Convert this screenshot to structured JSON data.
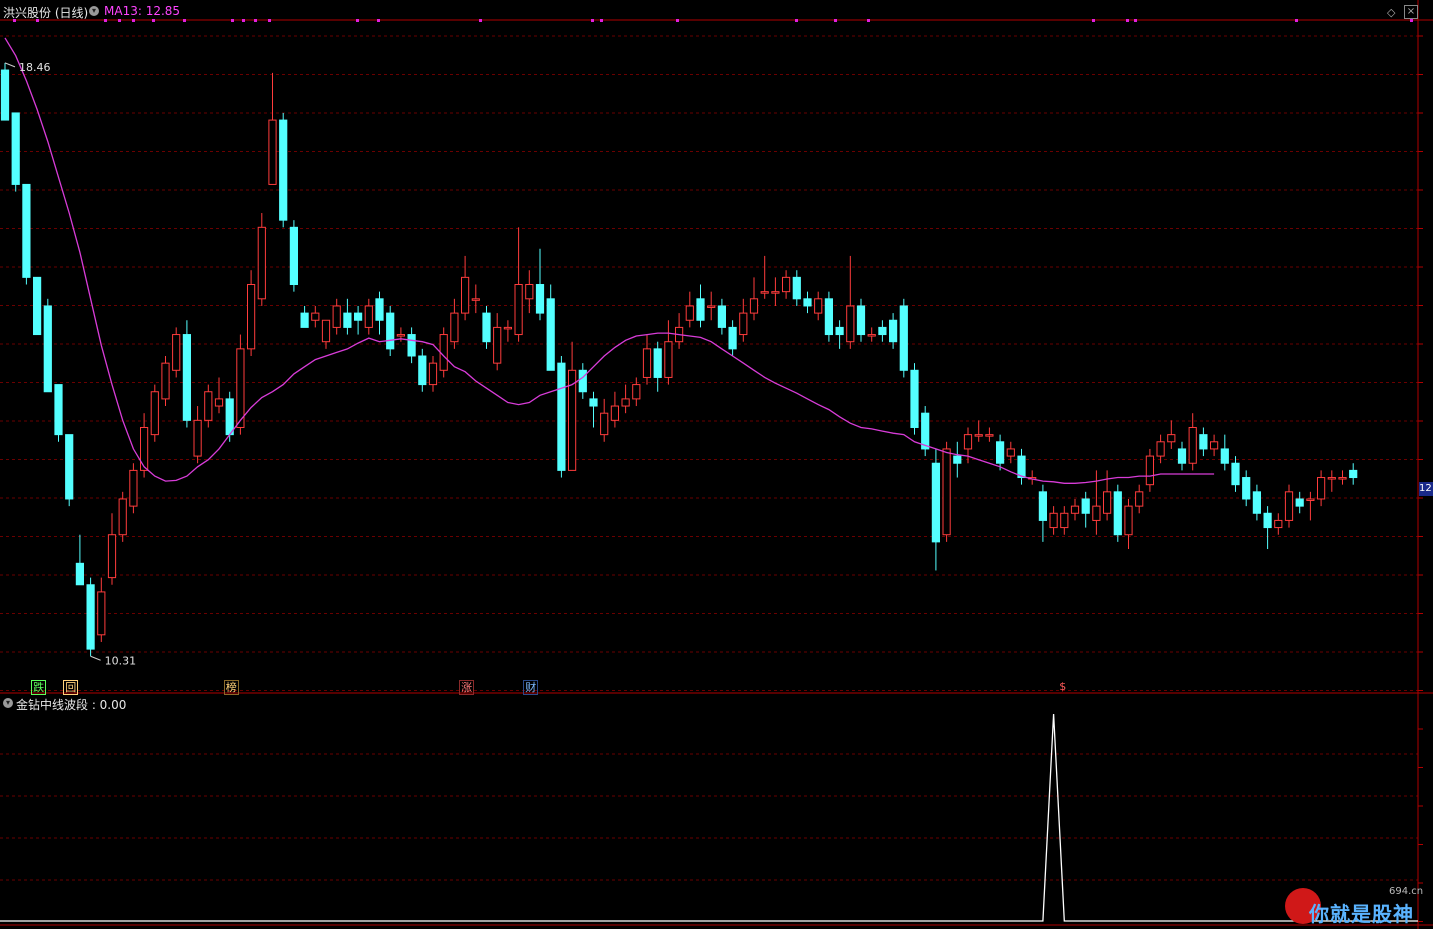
{
  "header": {
    "stock_name": "洪兴股份 (日线)",
    "ma_label": "MA13: 12.85"
  },
  "indicator": {
    "name": "金钻中线波段",
    "value": "0.00",
    "label": "金钻中线波段 : 0.00"
  },
  "price_tag": "12",
  "signals": [
    {
      "text": "跌",
      "color": "#5cff5c",
      "border": "#5cff5c",
      "index": 3
    },
    {
      "text": "回",
      "color": "#ffd27a",
      "border": "#ffd27a",
      "index": 6
    },
    {
      "text": "榜",
      "color": "#ffd27a",
      "border": "#8a6a2a",
      "index": 21
    },
    {
      "text": "涨",
      "color": "#ff7a7a",
      "border": "#8a2a2a",
      "index": 43
    },
    {
      "text": "财",
      "color": "#7ab8ff",
      "border": "#2a4a8a",
      "index": 49
    },
    {
      "text": "$",
      "color": "#ff5a5a",
      "border": "none",
      "index": 99
    }
  ],
  "watermark": {
    "text": "你就是股神",
    "url": "694.cn"
  },
  "colors": {
    "up": "#ff3c3c",
    "down": "#54ffff",
    "ma": "#d83cd8",
    "grid": "#6a0000",
    "frame": "#b00000",
    "indicator_line": "#ffffff"
  },
  "chart_data": {
    "type": "candlestick",
    "ylim": [
      9.8,
      19.2
    ],
    "high_annotation": "18.46",
    "low_annotation": "10.31",
    "series": [
      {
        "name": "MA13",
        "values": [
          18.95,
          18.7,
          18.35,
          17.95,
          17.5,
          17.0,
          16.5,
          15.95,
          15.3,
          14.65,
          14.1,
          13.6,
          13.2,
          12.95,
          12.82,
          12.75,
          12.76,
          12.82,
          12.95,
          13.05,
          13.2,
          13.4,
          13.6,
          13.78,
          13.92,
          14.0,
          14.1,
          14.25,
          14.35,
          14.45,
          14.5,
          14.55,
          14.6,
          14.68,
          14.75,
          14.7,
          14.72,
          14.74,
          14.72,
          14.7,
          14.66,
          14.5,
          14.35,
          14.28,
          14.15,
          14.05,
          13.95,
          13.85,
          13.82,
          13.85,
          13.95,
          14.0,
          14.05,
          14.1,
          14.2,
          14.35,
          14.5,
          14.62,
          14.72,
          14.78,
          14.8,
          14.82,
          14.82,
          14.8,
          14.78,
          14.76,
          14.7,
          14.6,
          14.5,
          14.4,
          14.3,
          14.2,
          14.12,
          14.05,
          13.98,
          13.9,
          13.82,
          13.75,
          13.65,
          13.56,
          13.5,
          13.48,
          13.45,
          13.42,
          13.4,
          13.3,
          13.25,
          13.2,
          13.15,
          13.12,
          13.1,
          13.05,
          13.0,
          12.95,
          12.88,
          12.82,
          12.78,
          12.75,
          12.74,
          12.72,
          12.72,
          12.73,
          12.75,
          12.78,
          12.8,
          12.8,
          12.82,
          12.82,
          12.85,
          12.85,
          12.85,
          12.85,
          12.85,
          12.85
        ]
      }
    ],
    "candles": [
      [
        18.5,
        17.8,
        18.6,
        17.8
      ],
      [
        17.9,
        16.9,
        17.9,
        16.8
      ],
      [
        16.9,
        15.6,
        16.9,
        15.5
      ],
      [
        15.6,
        14.8,
        15.6,
        14.8
      ],
      [
        15.2,
        14.0,
        15.3,
        14.0
      ],
      [
        14.1,
        13.4,
        14.1,
        13.3
      ],
      [
        13.4,
        12.5,
        13.4,
        12.4
      ],
      [
        11.6,
        11.3,
        12.0,
        11.3
      ],
      [
        11.3,
        10.4,
        11.4,
        10.3
      ],
      [
        10.6,
        11.2,
        11.4,
        10.5
      ],
      [
        11.4,
        12.0,
        12.3,
        11.3
      ],
      [
        12.0,
        12.5,
        12.6,
        11.9
      ],
      [
        12.4,
        12.9,
        13.0,
        12.3
      ],
      [
        12.9,
        13.5,
        13.7,
        12.8
      ],
      [
        13.4,
        14.0,
        14.1,
        13.3
      ],
      [
        13.9,
        14.4,
        14.5,
        13.8
      ],
      [
        14.3,
        14.8,
        14.9,
        14.2
      ],
      [
        14.8,
        13.6,
        15.0,
        13.5
      ],
      [
        13.1,
        13.6,
        13.8,
        13.0
      ],
      [
        13.6,
        14.0,
        14.1,
        13.5
      ],
      [
        13.8,
        13.9,
        14.2,
        13.7
      ],
      [
        13.9,
        13.4,
        14.0,
        13.3
      ],
      [
        13.5,
        14.6,
        14.8,
        13.4
      ],
      [
        14.6,
        15.5,
        15.7,
        14.5
      ],
      [
        15.3,
        16.3,
        16.5,
        15.2
      ],
      [
        16.9,
        17.8,
        18.46,
        16.9
      ],
      [
        17.8,
        16.4,
        17.9,
        16.3
      ],
      [
        16.3,
        15.5,
        16.4,
        15.4
      ],
      [
        15.1,
        14.9,
        15.2,
        14.9
      ],
      [
        15.0,
        15.1,
        15.2,
        14.9
      ],
      [
        14.7,
        15.0,
        15.0,
        14.6
      ],
      [
        14.9,
        15.2,
        15.3,
        14.8
      ],
      [
        15.1,
        14.9,
        15.3,
        14.8
      ],
      [
        15.1,
        15.0,
        15.2,
        14.8
      ],
      [
        14.9,
        15.2,
        15.3,
        14.8
      ],
      [
        15.3,
        15.0,
        15.4,
        14.8
      ],
      [
        15.1,
        14.6,
        15.2,
        14.5
      ],
      [
        14.8,
        14.8,
        14.9,
        14.7
      ],
      [
        14.8,
        14.5,
        14.9,
        14.4
      ],
      [
        14.5,
        14.1,
        14.6,
        14.0
      ],
      [
        14.1,
        14.4,
        14.5,
        14.0
      ],
      [
        14.3,
        14.8,
        14.9,
        14.2
      ],
      [
        14.7,
        15.1,
        15.3,
        14.6
      ],
      [
        15.1,
        15.6,
        15.9,
        15.0
      ],
      [
        15.3,
        15.3,
        15.5,
        15.1
      ],
      [
        15.1,
        14.7,
        15.2,
        14.6
      ],
      [
        14.4,
        14.9,
        15.1,
        14.3
      ],
      [
        14.9,
        14.9,
        15.0,
        14.7
      ],
      [
        14.8,
        15.5,
        16.3,
        14.7
      ],
      [
        15.3,
        15.5,
        15.7,
        15.1
      ],
      [
        15.5,
        15.1,
        16.0,
        15.0
      ],
      [
        15.3,
        14.3,
        15.5,
        14.3
      ],
      [
        14.4,
        12.9,
        14.5,
        12.8
      ],
      [
        12.9,
        14.3,
        14.7,
        12.9
      ],
      [
        14.3,
        14.0,
        14.4,
        13.9
      ],
      [
        13.9,
        13.8,
        14.0,
        13.5
      ],
      [
        13.4,
        13.7,
        13.9,
        13.3
      ],
      [
        13.6,
        13.8,
        14.0,
        13.5
      ],
      [
        13.8,
        13.9,
        14.1,
        13.7
      ],
      [
        13.9,
        14.1,
        14.2,
        13.8
      ],
      [
        14.2,
        14.6,
        14.8,
        14.1
      ],
      [
        14.6,
        14.2,
        14.7,
        14.0
      ],
      [
        14.2,
        14.7,
        15.0,
        14.1
      ],
      [
        14.7,
        14.9,
        15.1,
        14.6
      ],
      [
        15.0,
        15.2,
        15.4,
        14.9
      ],
      [
        15.3,
        15.0,
        15.5,
        14.9
      ],
      [
        15.2,
        15.2,
        15.4,
        15.0
      ],
      [
        15.2,
        14.9,
        15.3,
        14.8
      ],
      [
        14.9,
        14.6,
        15.0,
        14.5
      ],
      [
        14.8,
        15.1,
        15.3,
        14.7
      ],
      [
        15.1,
        15.3,
        15.6,
        15.0
      ],
      [
        15.4,
        15.4,
        15.9,
        15.3
      ],
      [
        15.4,
        15.4,
        15.6,
        15.2
      ],
      [
        15.4,
        15.6,
        15.7,
        15.3
      ],
      [
        15.6,
        15.3,
        15.7,
        15.2
      ],
      [
        15.3,
        15.2,
        15.4,
        15.1
      ],
      [
        15.1,
        15.3,
        15.4,
        15.0
      ],
      [
        15.3,
        14.8,
        15.4,
        14.7
      ],
      [
        14.9,
        14.8,
        15.0,
        14.6
      ],
      [
        14.7,
        15.2,
        15.9,
        14.6
      ],
      [
        15.2,
        14.8,
        15.3,
        14.7
      ],
      [
        14.8,
        14.8,
        14.9,
        14.7
      ],
      [
        14.9,
        14.8,
        15.0,
        14.7
      ],
      [
        15.0,
        14.7,
        15.1,
        14.6
      ],
      [
        15.2,
        14.3,
        15.3,
        14.2
      ],
      [
        14.3,
        13.5,
        14.4,
        13.4
      ],
      [
        13.7,
        13.2,
        13.8,
        13.1
      ],
      [
        13.0,
        11.9,
        13.2,
        11.5
      ],
      [
        12.0,
        13.2,
        13.3,
        11.9
      ],
      [
        13.1,
        13.0,
        13.3,
        12.8
      ],
      [
        13.2,
        13.4,
        13.5,
        13.0
      ],
      [
        13.4,
        13.4,
        13.6,
        13.3
      ],
      [
        13.4,
        13.4,
        13.5,
        13.3
      ],
      [
        13.3,
        13.0,
        13.4,
        12.9
      ],
      [
        13.1,
        13.2,
        13.3,
        13.0
      ],
      [
        13.1,
        12.8,
        13.2,
        12.7
      ],
      [
        12.8,
        12.8,
        12.9,
        12.7
      ],
      [
        12.6,
        12.2,
        12.7,
        11.9
      ],
      [
        12.1,
        12.3,
        12.4,
        12.0
      ],
      [
        12.1,
        12.3,
        12.4,
        12.0
      ],
      [
        12.3,
        12.4,
        12.5,
        12.2
      ],
      [
        12.5,
        12.3,
        12.6,
        12.1
      ],
      [
        12.2,
        12.4,
        12.9,
        12.0
      ],
      [
        12.3,
        12.6,
        12.9,
        12.2
      ],
      [
        12.6,
        12.0,
        12.7,
        11.9
      ],
      [
        12.0,
        12.4,
        12.5,
        11.8
      ],
      [
        12.4,
        12.6,
        12.7,
        12.3
      ],
      [
        12.7,
        13.1,
        13.2,
        12.6
      ],
      [
        13.1,
        13.3,
        13.4,
        13.0
      ],
      [
        13.3,
        13.4,
        13.6,
        13.2
      ],
      [
        13.2,
        13.0,
        13.3,
        12.9
      ],
      [
        13.0,
        13.5,
        13.7,
        12.9
      ],
      [
        13.4,
        13.2,
        13.5,
        13.1
      ],
      [
        13.2,
        13.3,
        13.4,
        13.1
      ],
      [
        13.2,
        13.0,
        13.4,
        12.9
      ],
      [
        13.0,
        12.7,
        13.1,
        12.6
      ],
      [
        12.8,
        12.5,
        12.9,
        12.4
      ],
      [
        12.6,
        12.3,
        12.7,
        12.2
      ],
      [
        12.3,
        12.1,
        12.4,
        11.8
      ],
      [
        12.1,
        12.2,
        12.3,
        12.0
      ],
      [
        12.2,
        12.6,
        12.7,
        12.1
      ],
      [
        12.5,
        12.4,
        12.6,
        12.3
      ],
      [
        12.5,
        12.5,
        12.6,
        12.2
      ],
      [
        12.5,
        12.8,
        12.9,
        12.4
      ],
      [
        12.8,
        12.8,
        12.9,
        12.6
      ],
      [
        12.8,
        12.8,
        12.9,
        12.7
      ],
      [
        12.9,
        12.8,
        13.0,
        12.7
      ]
    ],
    "indicator_values": {
      "zero_until": 96,
      "peak_index": 98,
      "peak_value": 1.0
    }
  }
}
